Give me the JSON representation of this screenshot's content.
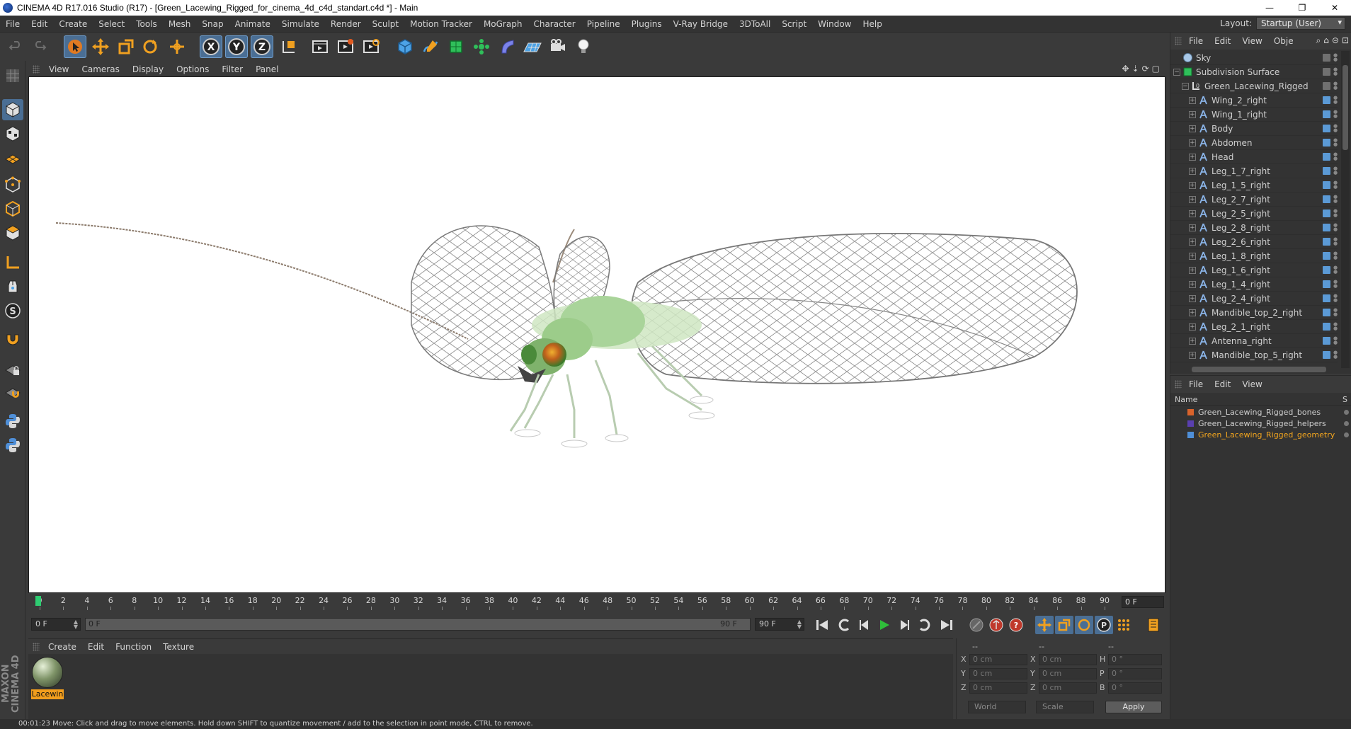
{
  "window": {
    "title": "CINEMA 4D R17.016 Studio (R17) - [Green_Lacewing_Rigged_for_cinema_4d_c4d_standart.c4d *] - Main",
    "min_glyph": "—",
    "restore_glyph": "❐",
    "close_glyph": "✕"
  },
  "menu": [
    "File",
    "Edit",
    "Create",
    "Select",
    "Tools",
    "Mesh",
    "Snap",
    "Animate",
    "Simulate",
    "Render",
    "Sculpt",
    "Motion Tracker",
    "MoGraph",
    "Character",
    "Pipeline",
    "Plugins",
    "V-Ray Bridge",
    "3DToAll",
    "Script",
    "Window",
    "Help"
  ],
  "layout": {
    "label": "Layout:",
    "value": "Startup (User)"
  },
  "toolbar": {
    "axis_x": "X",
    "axis_y": "Y",
    "axis_z": "Z"
  },
  "viewport": {
    "menu": [
      "View",
      "Cameras",
      "Display",
      "Options",
      "Filter",
      "Panel"
    ],
    "nav_icons": [
      "✥",
      "⇣",
      "⟳",
      "▢"
    ]
  },
  "timeline": {
    "ticks": [
      "0",
      "2",
      "4",
      "6",
      "8",
      "10",
      "12",
      "14",
      "16",
      "18",
      "20",
      "22",
      "24",
      "26",
      "28",
      "30",
      "32",
      "34",
      "36",
      "38",
      "40",
      "42",
      "44",
      "46",
      "48",
      "50",
      "52",
      "54",
      "56",
      "58",
      "60",
      "62",
      "64",
      "66",
      "68",
      "70",
      "72",
      "74",
      "76",
      "78",
      "80",
      "82",
      "84",
      "86",
      "88",
      "90"
    ],
    "current_frame": "0 F"
  },
  "transport": {
    "start_field": "0 F",
    "range_start": "0 F",
    "range_end": "90 F",
    "end_field": "90 F"
  },
  "material_manager": {
    "menu": [
      "Create",
      "Edit",
      "Function",
      "Texture"
    ],
    "materials": [
      {
        "name": "Lacewin"
      }
    ]
  },
  "coordinates": {
    "headers": [
      "--",
      "--",
      "--"
    ],
    "rows": [
      {
        "pos_label": "X",
        "pos": "0 cm",
        "size_label": "X",
        "size": "0 cm",
        "rot_label": "H",
        "rot": "0 °"
      },
      {
        "pos_label": "Y",
        "pos": "0 cm",
        "size_label": "Y",
        "size": "0 cm",
        "rot_label": "P",
        "rot": "0 °"
      },
      {
        "pos_label": "Z",
        "pos": "0 cm",
        "size_label": "Z",
        "size": "0 cm",
        "rot_label": "B",
        "rot": "0 °"
      }
    ],
    "space": "World",
    "mode": "Scale",
    "apply_label": "Apply"
  },
  "object_manager": {
    "menu": [
      "File",
      "Edit",
      "View",
      "Obje"
    ],
    "objects": [
      {
        "name": "Sky",
        "icon": "sky"
      },
      {
        "name": "Subdivision Surface",
        "icon": "subdiv"
      },
      {
        "name": "Green_Lacewing_Rigged",
        "icon": "null"
      },
      {
        "name": "Wing_2_right",
        "icon": "joint"
      },
      {
        "name": "Wing_1_right",
        "icon": "joint"
      },
      {
        "name": "Body",
        "icon": "joint"
      },
      {
        "name": "Abdomen",
        "icon": "joint"
      },
      {
        "name": "Head",
        "icon": "joint"
      },
      {
        "name": "Leg_1_7_right",
        "icon": "joint"
      },
      {
        "name": "Leg_1_5_right",
        "icon": "joint"
      },
      {
        "name": "Leg_2_7_right",
        "icon": "joint"
      },
      {
        "name": "Leg_2_5_right",
        "icon": "joint"
      },
      {
        "name": "Leg_2_8_right",
        "icon": "joint"
      },
      {
        "name": "Leg_2_6_right",
        "icon": "joint"
      },
      {
        "name": "Leg_1_8_right",
        "icon": "joint"
      },
      {
        "name": "Leg_1_6_right",
        "icon": "joint"
      },
      {
        "name": "Leg_1_4_right",
        "icon": "joint"
      },
      {
        "name": "Leg_2_4_right",
        "icon": "joint"
      },
      {
        "name": "Mandible_top_2_right",
        "icon": "joint"
      },
      {
        "name": "Leg_2_1_right",
        "icon": "joint"
      },
      {
        "name": "Antenna_right",
        "icon": "joint"
      },
      {
        "name": "Mandible_top_5_right",
        "icon": "joint"
      }
    ]
  },
  "layer_manager": {
    "menu": [
      "File",
      "Edit",
      "View"
    ],
    "col_name": "Name",
    "col_s": "S",
    "layers": [
      {
        "name": "Green_Lacewing_Rigged_bones",
        "color": "#d9632b",
        "text_color": "#cfcfcf"
      },
      {
        "name": "Green_Lacewing_Rigged_helpers",
        "color": "#5a3fb0",
        "text_color": "#cfcfcf"
      },
      {
        "name": "Green_Lacewing_Rigged_geometry",
        "color": "#4f8fd8",
        "text_color": "#f2a51f"
      }
    ]
  },
  "status": {
    "text": "00:01:23   Move: Click and drag to move elements. Hold down SHIFT to quantize movement / add to the selection in point mode, CTRL to remove."
  },
  "colors": {
    "accent_active": "#4a6e94",
    "selected_text": "#f2a51f",
    "playhead": "#2ecc71"
  }
}
